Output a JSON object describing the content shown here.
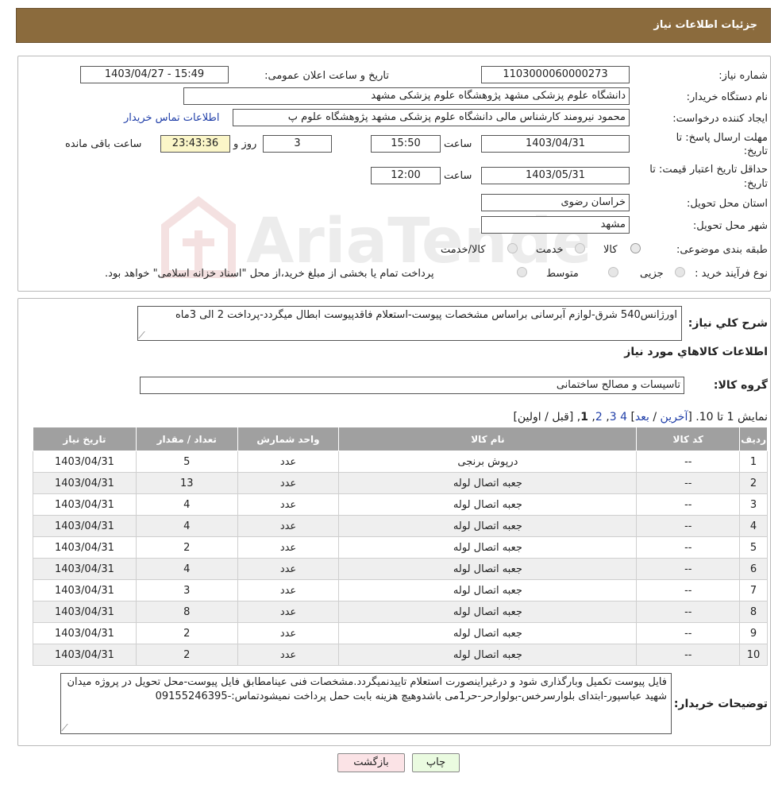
{
  "header": {
    "title": "جزئیات اطلاعات نیاز"
  },
  "info": {
    "need_number_label": "شماره نیاز:",
    "need_number": "1103000060000273",
    "announce_label": "تاریخ و ساعت اعلان عمومی:",
    "announce_value": "1403/04/27 - 15:49",
    "buyer_org_label": "نام دستگاه خریدار:",
    "buyer_org": "دانشگاه علوم پزشکی مشهد   پژوهشگاه علوم پزشکی مشهد",
    "creator_label": "ایجاد کننده درخواست:",
    "creator": "محمود نیرومند کارشناس مالی دانشگاه علوم پزشکی مشهد   پژوهشگاه علوم پ",
    "contact_link": "اطلاعات تماس خریدار",
    "deadline_label_1": "مهلت ارسال پاسخ: تا",
    "deadline_label_2": "تاریخ:",
    "deadline_date": "1403/04/31",
    "time_label": "ساعت",
    "deadline_time": "15:50",
    "days_value": "3",
    "days_label": "روز و",
    "remaining_time": "23:43:36",
    "remaining_label": "ساعت باقی مانده",
    "validity_label_1": "حداقل تاریخ اعتبار قیمت: تا",
    "validity_label_2": "تاریخ:",
    "validity_date": "1403/05/31",
    "validity_time": "12:00",
    "province_label": "استان محل تحویل:",
    "province": "خراسان رضوی",
    "city_label": "شهر محل تحویل:",
    "city": "مشهد",
    "category_label": "طبقه بندی موضوعی:",
    "category_options": [
      "کالا",
      "خدمت",
      "کالا/خدمت"
    ],
    "process_label": "نوع فرآیند خرید :",
    "process_options": [
      "جزیی",
      "متوسط"
    ],
    "process_note": "پرداخت تمام یا بخشی از مبلغ خرید،از محل \"اسناد خزانه اسلامی\" خواهد بود."
  },
  "summary": {
    "label": "شرح کلي نياز:",
    "text": "اورژانس540 شرق-لوازم آبرسانی براساس مشخصات پیوست-استعلام فاقدپیوست ابطال میگردد-پرداخت 2 الی 3ماه"
  },
  "goods": {
    "section_title": "اطلاعات کالاهاي مورد نياز",
    "group_label": "گروه کالا:",
    "group_value": "تاسیسات و مصالح ساختمانی"
  },
  "pager": {
    "prefix": "نمایش 1 تا 10.  [",
    "last": "آخرین",
    "sep": " / ",
    "next": "بعد",
    "pages": [
      "4",
      "3",
      "2"
    ],
    "current": "1",
    "suffix": " [قبل / اولین]",
    "close": "]"
  },
  "table": {
    "headers": [
      "ردیف",
      "کد کالا",
      "نام کالا",
      "واحد شمارش",
      "تعداد / مقدار",
      "تاریخ نیاز"
    ],
    "rows": [
      [
        "1",
        "--",
        "درپوش برنجی",
        "عدد",
        "5",
        "1403/04/31"
      ],
      [
        "2",
        "--",
        "جعبه اتصال لوله",
        "عدد",
        "13",
        "1403/04/31"
      ],
      [
        "3",
        "--",
        "جعبه اتصال لوله",
        "عدد",
        "4",
        "1403/04/31"
      ],
      [
        "4",
        "--",
        "جعبه اتصال لوله",
        "عدد",
        "4",
        "1403/04/31"
      ],
      [
        "5",
        "--",
        "جعبه اتصال لوله",
        "عدد",
        "2",
        "1403/04/31"
      ],
      [
        "6",
        "--",
        "جعبه اتصال لوله",
        "عدد",
        "4",
        "1403/04/31"
      ],
      [
        "7",
        "--",
        "جعبه اتصال لوله",
        "عدد",
        "3",
        "1403/04/31"
      ],
      [
        "8",
        "--",
        "جعبه اتصال لوله",
        "عدد",
        "8",
        "1403/04/31"
      ],
      [
        "9",
        "--",
        "جعبه اتصال لوله",
        "عدد",
        "2",
        "1403/04/31"
      ],
      [
        "10",
        "--",
        "جعبه اتصال لوله",
        "عدد",
        "2",
        "1403/04/31"
      ]
    ]
  },
  "buyer_notes": {
    "label": "توضیحات خریدار:",
    "text": "فایل پیوست تکمیل وبارگذاری شود و درغیراینصورت استعلام تاییدنمیگردد.مشخصات فنی عینامطابق فایل پیوست-محل تحویل در پروژه میدان شهید عباسپور-ابتدای بلوارسرخس-بولوارحر-حر1می باشدوهیچ هزینه بابت حمل پرداخت نمیشودتماس:-09155246395"
  },
  "buttons": {
    "print": "چاپ",
    "back": "بازگشت"
  },
  "watermark": {
    "text": "AriaTender.neT"
  },
  "colors": {
    "header": "#8b6b3d",
    "table_header": "#a0a0a0",
    "back_button": "#fbe3e6",
    "print_button": "#eafbe0",
    "remaining": "#fbf6c8"
  }
}
